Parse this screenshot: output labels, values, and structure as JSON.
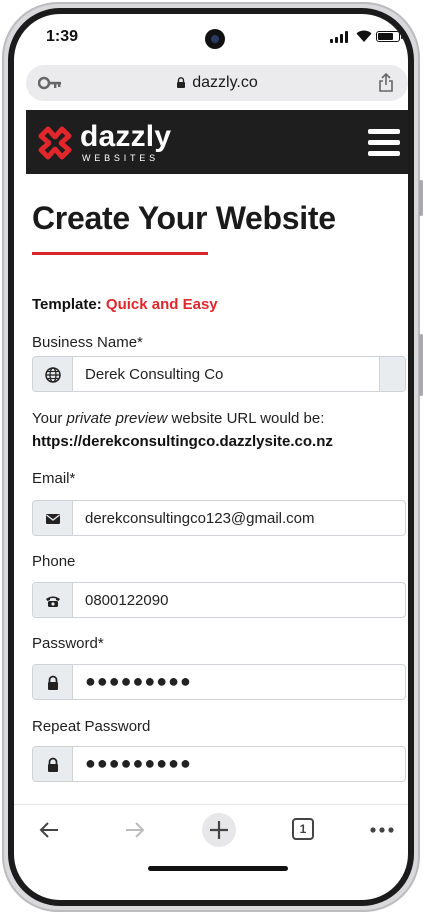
{
  "status_bar": {
    "time": "1:39"
  },
  "browser": {
    "url": "dazzly.co"
  },
  "site": {
    "logo_word": "dazzly",
    "logo_sub": "WEBSITES",
    "brand_color": "#e1272c"
  },
  "page": {
    "title": "Create Your Website",
    "template_label": "Template:",
    "template_value": "Quick and Easy"
  },
  "form": {
    "business_name": {
      "label": "Business Name*",
      "value": "Derek Consulting Co"
    },
    "preview_text_before": "Your ",
    "preview_text_italic": "private preview",
    "preview_text_after": " website URL would be:",
    "preview_url": "https://derekconsultingco.dazzlysite.co.nz",
    "email": {
      "label": "Email*",
      "value": "derekconsultingco123@gmail.com"
    },
    "phone": {
      "label": "Phone",
      "value": "0800122090"
    },
    "password": {
      "label": "Password*",
      "value": "●●●●●●●●●"
    },
    "repeat_password": {
      "label": "Repeat Password",
      "value": "●●●●●●●●●"
    }
  },
  "bottom_nav": {
    "tab_count": "1"
  }
}
